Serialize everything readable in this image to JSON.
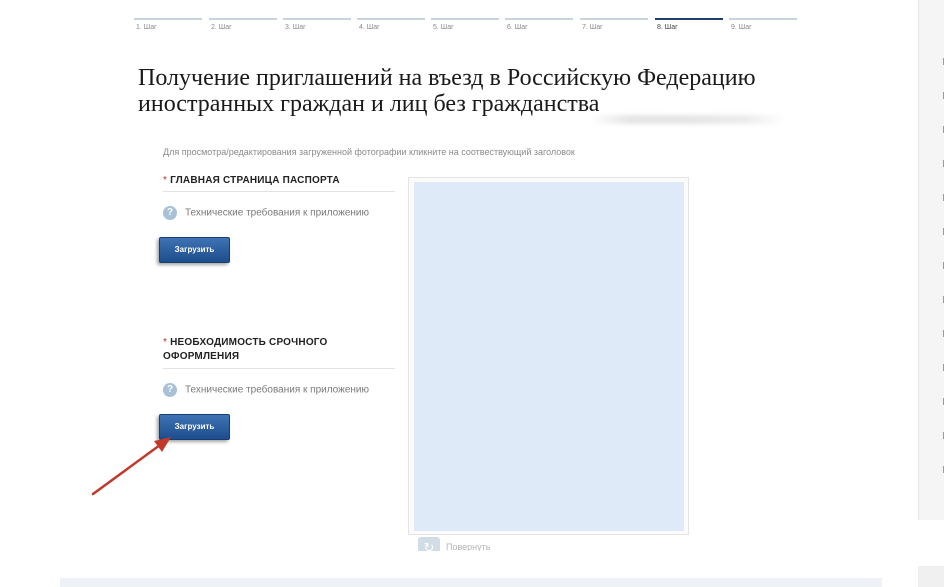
{
  "steps": [
    {
      "label": "1. Шаг",
      "active": false
    },
    {
      "label": "2. Шаг",
      "active": false
    },
    {
      "label": "3. Шаг",
      "active": false
    },
    {
      "label": "4. Шаг",
      "active": false
    },
    {
      "label": "5. Шаг",
      "active": false
    },
    {
      "label": "6. Шаг",
      "active": false
    },
    {
      "label": "7. Шаг",
      "active": false
    },
    {
      "label": "8. Шаг",
      "active": true
    },
    {
      "label": "9. Шаг",
      "active": false
    }
  ],
  "page": {
    "title": "Получение приглашений на въезд в Российскую Федерацию иностранных граждан и лиц без гражданства",
    "hint": "Для просмотра/редактирования загруженной фотографии кликните на соотвествующий заголовок"
  },
  "sections": [
    {
      "required_mark": "*",
      "title": "ГЛАВНАЯ СТРАНИЦА ПАСПОРТА",
      "requirements_link": "Технические требования к приложению",
      "upload_label": "Загрузить"
    },
    {
      "required_mark": "*",
      "title": "НЕОБХОДИМОСТЬ СРОЧНОГО ОФОРМЛЕНИЯ",
      "requirements_link": "Технические требования к приложению",
      "upload_label": "Загрузить"
    }
  ],
  "preview": {
    "rotate_label": "Повернуть"
  },
  "icons": {
    "help": "question-icon",
    "rotate": "rotate-icon",
    "annotation": "red-arrow"
  },
  "colors": {
    "button": "#1d4d8c",
    "active_step": "#1f3f6b",
    "preview_bg": "#dfeaf8",
    "required": "#c62828",
    "annotation_arrow": "#c0392b"
  }
}
